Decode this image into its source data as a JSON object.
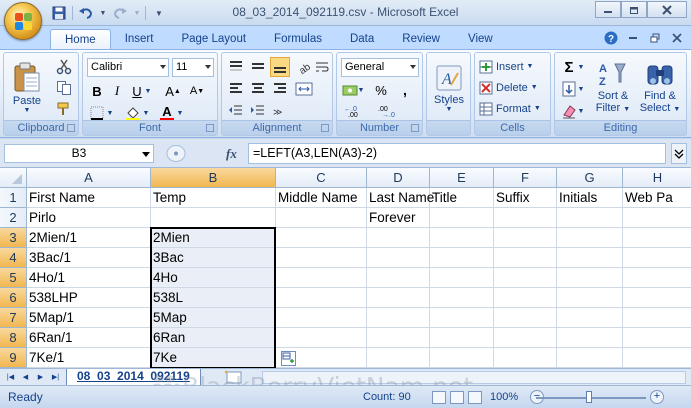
{
  "window": {
    "title": "08_03_2014_092119.csv - Microsoft Excel"
  },
  "tabs": [
    "Home",
    "Insert",
    "Page Layout",
    "Formulas",
    "Data",
    "Review",
    "View"
  ],
  "ribbon": {
    "clipboard": {
      "paste_label": "Paste",
      "group_label": "Clipboard"
    },
    "font": {
      "font_name": "Calibri",
      "font_size": "11",
      "group_label": "Font"
    },
    "alignment": {
      "group_label": "Alignment"
    },
    "number": {
      "format": "General",
      "group_label": "Number",
      "percent": "%",
      "comma": ","
    },
    "styles": {
      "label": "Styles"
    },
    "cells": {
      "insert": "Insert",
      "delete": "Delete",
      "format": "Format",
      "group_label": "Cells"
    },
    "editing": {
      "sort_filter": "Sort &\nFilter",
      "sort_line1": "Sort &",
      "sort_line2": "Filter",
      "find_line1": "Find &",
      "find_line2": "Select",
      "group_label": "Editing"
    }
  },
  "formula_bar": {
    "name_box": "B3",
    "fx": "fx",
    "formula": "=LEFT(A3,LEN(A3)-2)"
  },
  "grid": {
    "columns": [
      "A",
      "B",
      "C",
      "D",
      "E",
      "F",
      "G",
      "H"
    ],
    "rows": [
      {
        "num": "1",
        "cells": [
          "First Name",
          "Temp",
          "Middle Name",
          "Last Name",
          "Title",
          "Suffix",
          "Initials",
          "Web Pa"
        ]
      },
      {
        "num": "2",
        "cells": [
          "Pirlo",
          "",
          "",
          "Forever",
          "",
          "",
          "",
          ""
        ]
      },
      {
        "num": "3",
        "cells": [
          "2Mien/1",
          "2Mien",
          "",
          "",
          "",
          "",
          "",
          ""
        ]
      },
      {
        "num": "4",
        "cells": [
          "3Bac/1",
          "3Bac",
          "",
          "",
          "",
          "",
          "",
          ""
        ]
      },
      {
        "num": "5",
        "cells": [
          "4Ho/1",
          "4Ho",
          "",
          "",
          "",
          "",
          "",
          ""
        ]
      },
      {
        "num": "6",
        "cells": [
          "538LHP",
          "538L",
          "",
          "",
          "",
          "",
          "",
          ""
        ]
      },
      {
        "num": "7",
        "cells": [
          "5Map/1",
          "5Map",
          "",
          "",
          "",
          "",
          "",
          ""
        ]
      },
      {
        "num": "8",
        "cells": [
          "6Ran/1",
          "6Ran",
          "",
          "",
          "",
          "",
          "",
          ""
        ]
      },
      {
        "num": "9",
        "cells": [
          "7Ke/1",
          "7Ke",
          "",
          "",
          "",
          "",
          "",
          ""
        ]
      }
    ]
  },
  "sheet": {
    "tab_name": "08_03_2014_092119"
  },
  "status": {
    "ready": "Ready",
    "count": "Count: 90",
    "zoom": "100%"
  },
  "watermark": "BlackBerryVietNam.net",
  "colors": {
    "accent": "#15428b",
    "selected_header": "#f1b64e",
    "ribbon_bg": "#dbe5f4"
  }
}
